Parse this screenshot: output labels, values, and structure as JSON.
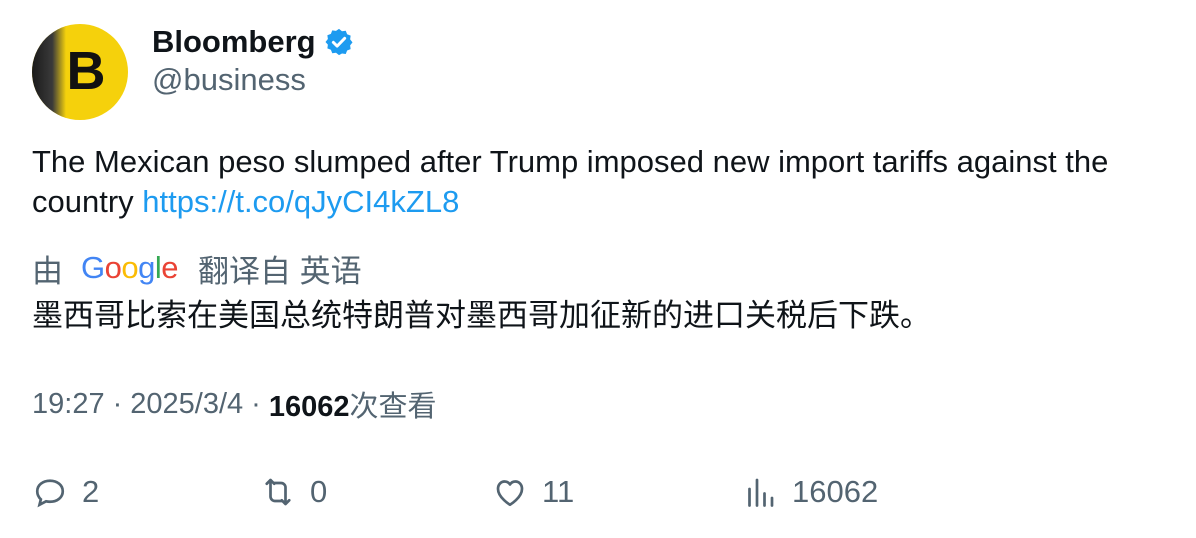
{
  "author": {
    "name": "Bloomberg",
    "handle": "@business",
    "avatar_letter": "B",
    "avatar_color": "#f5d10c",
    "verified_color": "#1d9bf0"
  },
  "tweet": {
    "text": "The Mexican peso slumped after Trump imposed new import tariffs against the country ",
    "link": "https://t.co/qJyCI4kZL8",
    "link_color": "#1d9bf0"
  },
  "translation": {
    "prefix": "由",
    "provider_letters": [
      "G",
      "o",
      "o",
      "g",
      "l",
      "e"
    ],
    "suffix": "翻译自 英语",
    "text": "墨西哥比索在美国总统特朗普对墨西哥加征新的进口关税后下跌。"
  },
  "meta": {
    "time": "19:27",
    "sep1": "·",
    "date": "2025/3/4",
    "sep2": "·",
    "views": "16062",
    "views_label": "次查看"
  },
  "actions": {
    "replies": "2",
    "reposts": "0",
    "likes": "11",
    "views": "16062"
  }
}
